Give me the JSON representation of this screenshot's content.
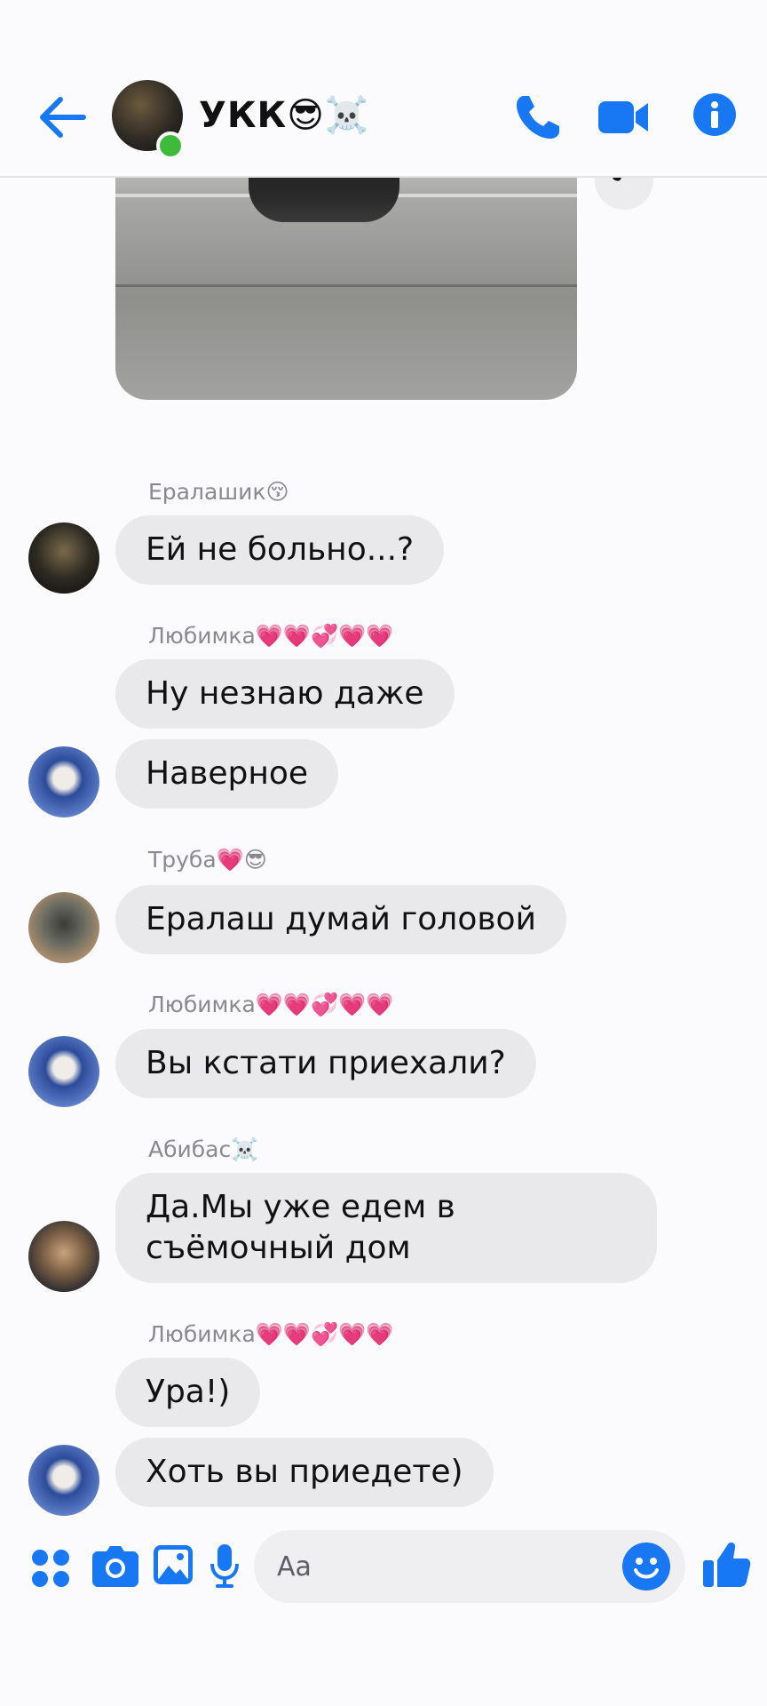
{
  "header": {
    "title": "УКК😎☠️"
  },
  "messages": [
    {
      "sender": "Ералашик😚",
      "texts": [
        "Ей не больно...?"
      ]
    },
    {
      "sender": "Любимка💗💗💞💗💗",
      "texts": [
        "Ну незнаю даже",
        "Наверное"
      ]
    },
    {
      "sender": "Труба💗😎",
      "texts": [
        "Ералаш думай головой"
      ]
    },
    {
      "sender": "Любимка💗💗💞💗💗",
      "texts": [
        "Вы кстати приехали?"
      ]
    },
    {
      "sender": "Абибас☠️",
      "texts": [
        "Да.Мы уже едем в съёмочный дом"
      ]
    },
    {
      "sender": "Любимка💗💗💞💗💗",
      "texts": [
        "Ура!)",
        "Хоть вы приедете)"
      ]
    }
  ],
  "composer": {
    "placeholder": "Aa"
  },
  "colors": {
    "accent": "#1877f2",
    "bubble": "#e9e9ec",
    "online": "#3fba3a"
  }
}
